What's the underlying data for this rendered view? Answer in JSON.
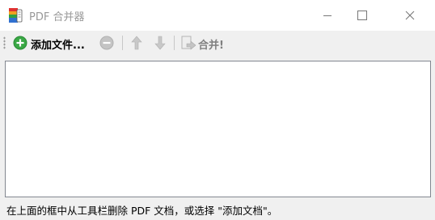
{
  "window": {
    "title": "PDF 合并器",
    "app_icon": "colored-books-icon",
    "controls": {
      "minimize": "minimize-icon",
      "maximize": "maximize-icon",
      "close": "close-icon"
    }
  },
  "toolbar": {
    "add_files_label": "添加文件...",
    "merge_label": "合并!",
    "icons": {
      "add": "plus-circle-icon",
      "remove": "minus-circle-icon",
      "move_up": "arrow-up-icon",
      "move_down": "arrow-down-icon",
      "merge": "document-arrow-icon"
    }
  },
  "file_list": {
    "items": []
  },
  "status": {
    "text": "在上面的框中从工具栏删除 PDF 文档，或选择 \"添加文档\"。"
  },
  "colors": {
    "titlebar_bg": "#ffffff",
    "window_bg": "#f0f0f0",
    "list_border": "#828790",
    "add_icon_green": "#3aa845",
    "disabled_gray": "#b4b4b4"
  }
}
